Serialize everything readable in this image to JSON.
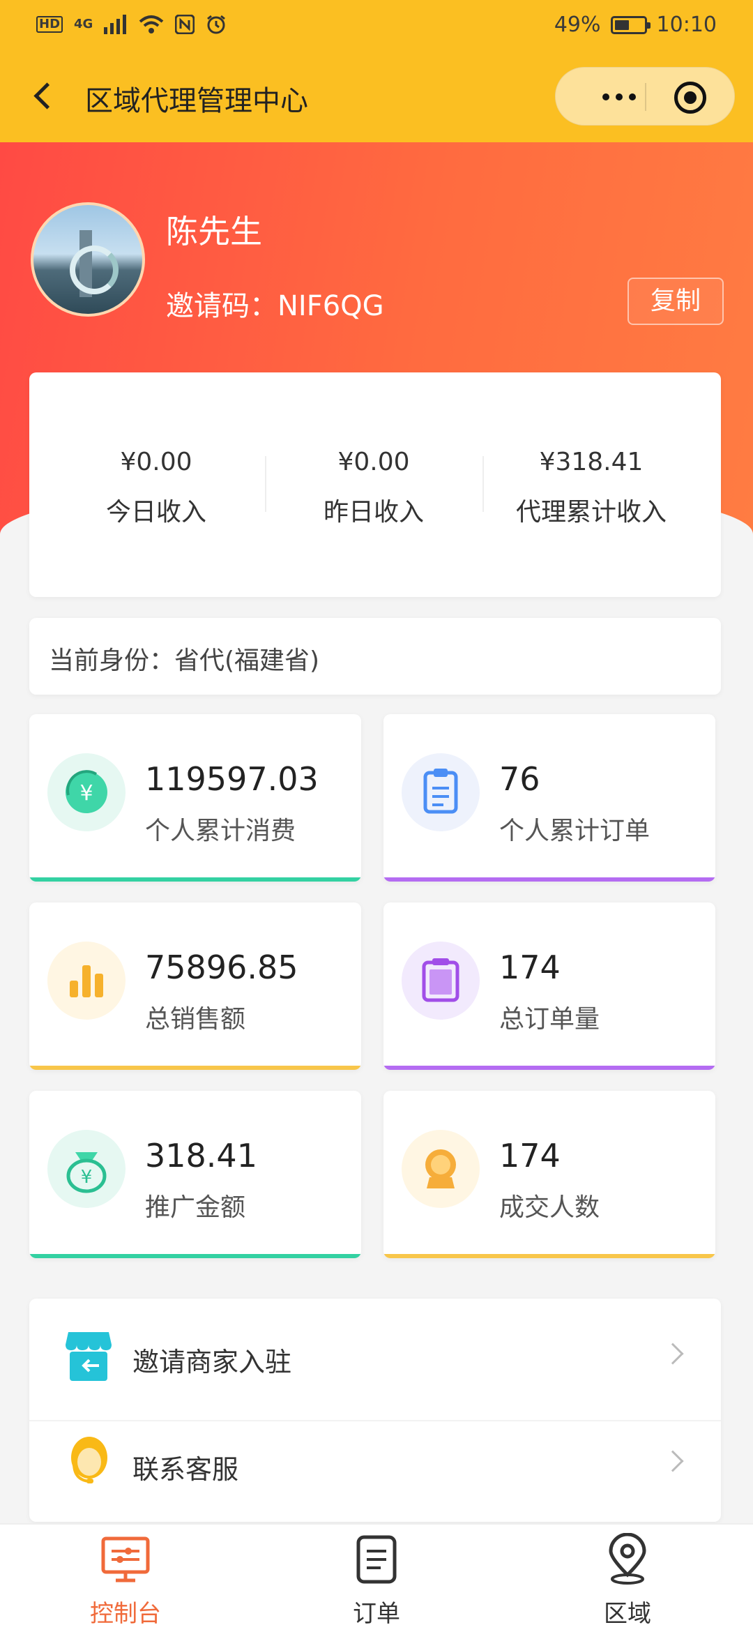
{
  "status_bar": {
    "network": "4G",
    "battery": "49%",
    "battery_level": 0.49,
    "time": "10:10"
  },
  "nav": {
    "title": "区域代理管理中心"
  },
  "profile": {
    "name": "陈先生",
    "invite_label": "邀请码：NIF6QG",
    "copy_label": "复制"
  },
  "income": [
    {
      "value": "¥0.00",
      "label": "今日收入"
    },
    {
      "value": "¥0.00",
      "label": "昨日收入"
    },
    {
      "value": "¥318.41",
      "label": "代理累计收入"
    }
  ],
  "identity": "当前身份：省代(福建省)",
  "stats": [
    {
      "value": "119597.03",
      "label": "个人累计消费",
      "icon": "yen-coin-icon",
      "color": "#33d1a2"
    },
    {
      "value": "76",
      "label": "个人累计订单",
      "icon": "clipboard-icon",
      "color": "#b46cf2"
    },
    {
      "value": "75896.85",
      "label": "总销售额",
      "icon": "bar-chart-icon",
      "color": "#f8c64a"
    },
    {
      "value": "174",
      "label": "总订单量",
      "icon": "order-doc-icon",
      "color": "#b46cf2"
    },
    {
      "value": "318.41",
      "label": "推广金额",
      "icon": "money-bag-icon",
      "color": "#33d1a2"
    },
    {
      "value": "174",
      "label": "成交人数",
      "icon": "medal-icon",
      "color": "#f8c64a"
    }
  ],
  "menu": [
    {
      "label": "邀请商家入驻",
      "icon": "shop-invite-icon"
    },
    {
      "label": "联系客服",
      "icon": "customer-service-icon"
    }
  ],
  "tabs": [
    {
      "label": "控制台",
      "icon": "console-icon",
      "active": true
    },
    {
      "label": "订单",
      "icon": "order-list-icon",
      "active": false
    },
    {
      "label": "区域",
      "icon": "location-icon",
      "active": false
    }
  ]
}
